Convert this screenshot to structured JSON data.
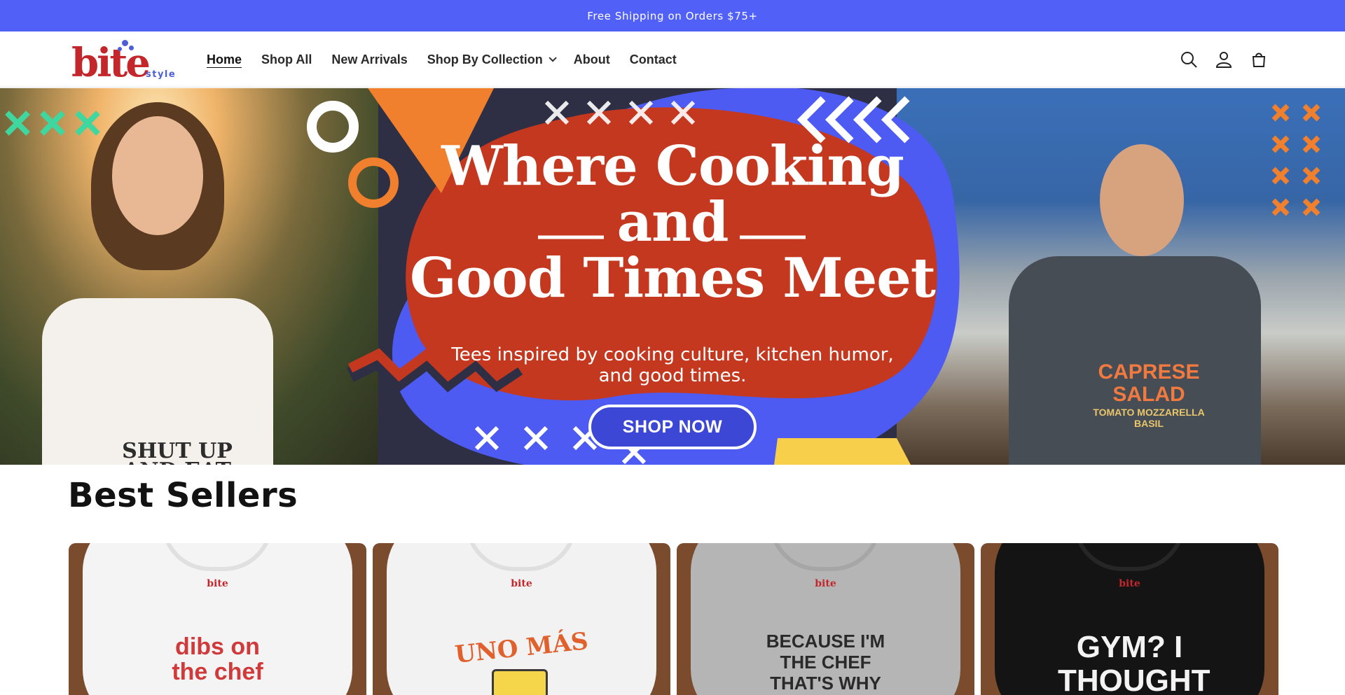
{
  "announcement": "Free Shipping on Orders $75+",
  "brand": {
    "name": "bite",
    "sub": "style",
    "color": "#c3272c",
    "accent": "#4d5fd6"
  },
  "nav": {
    "items": [
      {
        "label": "Home",
        "active": true
      },
      {
        "label": "Shop All"
      },
      {
        "label": "New Arrivals"
      },
      {
        "label": "Shop By Collection",
        "has_dropdown": true
      },
      {
        "label": "About"
      },
      {
        "label": "Contact"
      }
    ]
  },
  "header_icons": [
    "search-icon",
    "account-icon",
    "cart-icon"
  ],
  "hero": {
    "title_line1": "Where Cooking",
    "title_line2": "and",
    "title_line3": "Good Times Meet",
    "subtitle": "Tees inspired by cooking culture, kitchen humor, and good times.",
    "cta": "SHOP NOW",
    "left_tee_text": "SHUT UP AND EAT",
    "right_tee_title": "CAPRESE SALAD",
    "right_tee_detail": "TOMATO MOZZARELLA BASIL",
    "colors": {
      "blob": "#c4381f",
      "blue": "#4d5bf2",
      "dark": "#2e2f45",
      "orange": "#f07f2e",
      "yellow": "#f7cf4a"
    }
  },
  "best_sellers": {
    "title": "Best Sellers",
    "cards": [
      {
        "print_text": "dibs on the chef",
        "tee_color": "#f4f4f4",
        "print_color": "#d13a3a",
        "mini_logo": "bite"
      },
      {
        "print_text": "UNO MÁS",
        "tee_color": "#f2f2f2",
        "print_color": "#e0612e",
        "mini_logo": "bite"
      },
      {
        "print_text": "BECAUSE I'M THE CHEF THAT'S WHY",
        "tee_color": "#b5b5b5",
        "print_color": "#2a2a2a",
        "mini_logo": "bite"
      },
      {
        "print_text": "GYM? I THOUGHT",
        "tee_color": "#141414",
        "print_color": "#f3f3f3",
        "mini_logo": "bite"
      }
    ]
  },
  "announcement_color": "#5161f7"
}
